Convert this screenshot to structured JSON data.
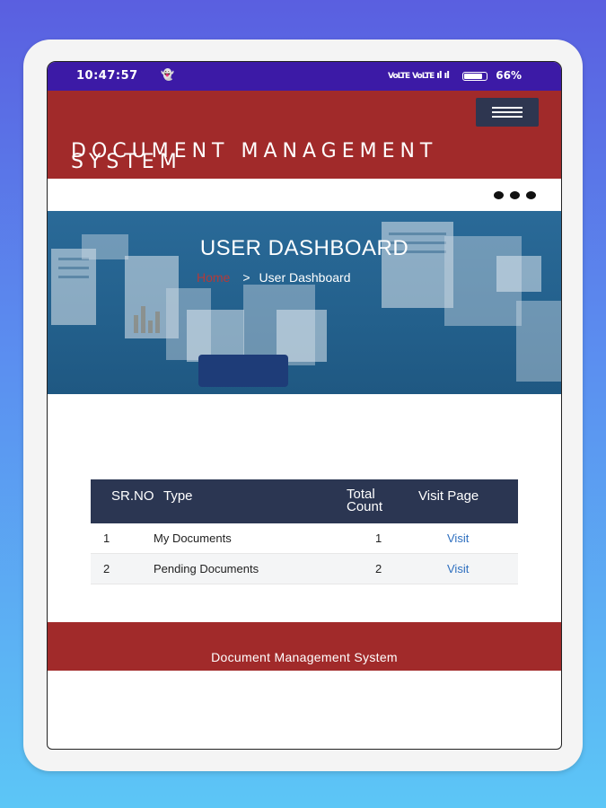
{
  "status_bar": {
    "time": "10:47:57",
    "notification_icon": "snapchat-ghost-icon",
    "signal_text": "ᵛᵒˡᵗᵉ ᵛᵒˡᵗᵉ ⁴ᴳ",
    "battery": "66%"
  },
  "header": {
    "title": "DOCUMENT MANAGEMENT SYSTEM",
    "menu_icon": "hamburger-icon",
    "bg_color": "#a12a2a"
  },
  "subbar": {
    "more_icon": "more-dots-icon"
  },
  "hero": {
    "title": "USER DASHBOARD",
    "breadcrumb": {
      "home": "Home",
      "separator": ">",
      "current": "User Dashboard"
    }
  },
  "table": {
    "columns": [
      "SR.NO",
      "Type",
      "Total Count",
      "Visit Page"
    ],
    "rows": [
      {
        "srno": "1",
        "type": "My Documents",
        "count": "1",
        "visit": "Visit"
      },
      {
        "srno": "2",
        "type": "Pending Documents",
        "count": "2",
        "visit": "Visit"
      }
    ]
  },
  "footer": {
    "text": "Document Management System"
  }
}
